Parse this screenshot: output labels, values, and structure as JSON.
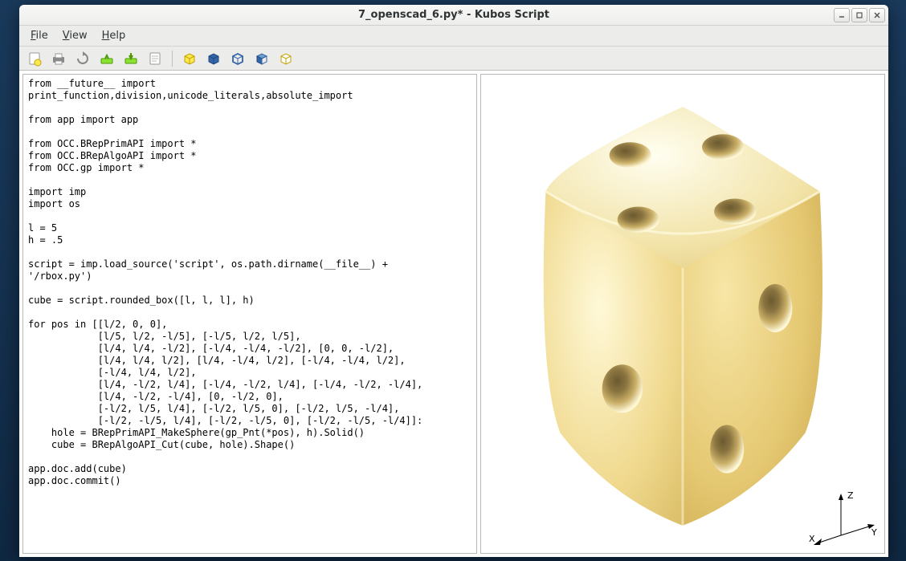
{
  "window": {
    "title": "7_openscad_6.py* - Kubos Script"
  },
  "menu": {
    "file": "File",
    "view": "View",
    "help": "Help"
  },
  "toolbar": {
    "new": "new-file-icon",
    "print": "print-icon",
    "refresh": "refresh-icon",
    "open": "open-icon",
    "save": "save-icon",
    "edit": "edit-icon",
    "shape1": "cube-solid-icon",
    "shape2": "cube-shaded-icon",
    "shape3": "cube-wire-icon",
    "shape4": "cube-front-icon",
    "shape5": "cube-outline-icon"
  },
  "editor": {
    "code": "from __future__ import\nprint_function,division,unicode_literals,absolute_import\n\nfrom app import app\n\nfrom OCC.BRepPrimAPI import *\nfrom OCC.BRepAlgoAPI import *\nfrom OCC.gp import *\n\nimport imp\nimport os\n\nl = 5\nh = .5\n\nscript = imp.load_source('script', os.path.dirname(__file__) +\n'/rbox.py')\n\ncube = script.rounded_box([l, l, l], h)\n\nfor pos in [[l/2, 0, 0],\n            [l/5, l/2, -l/5], [-l/5, l/2, l/5],\n            [l/4, l/4, -l/2], [-l/4, -l/4, -l/2], [0, 0, -l/2],\n            [l/4, l/4, l/2], [l/4, -l/4, l/2], [-l/4, -l/4, l/2],\n            [-l/4, l/4, l/2],\n            [l/4, -l/2, l/4], [-l/4, -l/2, l/4], [-l/4, -l/2, -l/4],\n            [l/4, -l/2, -l/4], [0, -l/2, 0],\n            [-l/2, l/5, l/4], [-l/2, l/5, 0], [-l/2, l/5, -l/4],\n            [-l/2, -l/5, l/4], [-l/2, -l/5, 0], [-l/2, -l/5, -l/4]]:\n    hole = BRepPrimAPI_MakeSphere(gp_Pnt(*pos), h).Solid()\n    cube = BRepAlgoAPI_Cut(cube, hole).Shape()\n\napp.doc.add(cube)\napp.doc.commit()"
  },
  "axes": {
    "x": "X",
    "y": "Y",
    "z": "Z"
  }
}
